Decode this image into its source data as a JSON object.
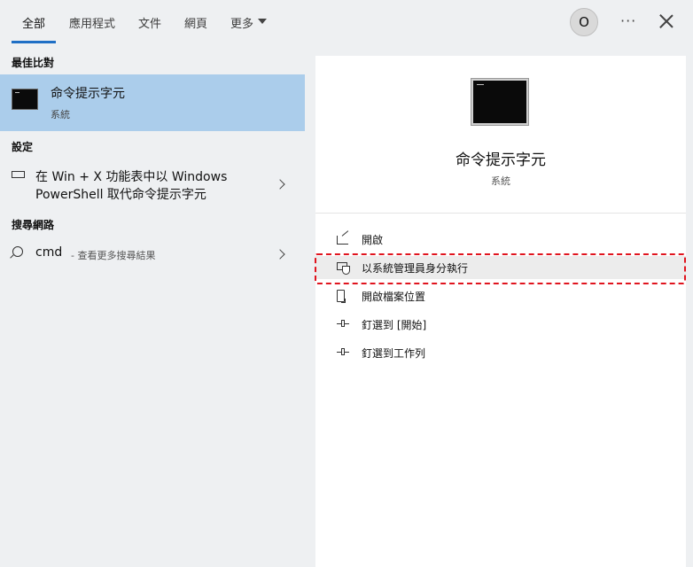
{
  "tabs": [
    {
      "label": "全部",
      "active": true
    },
    {
      "label": "應用程式"
    },
    {
      "label": "文件"
    },
    {
      "label": "網頁"
    },
    {
      "label": "更多"
    }
  ],
  "header": {
    "avatar_initial": "O",
    "more_label": "···"
  },
  "colors": {
    "accent": "#1f6fc5",
    "selected": "#abcdeb",
    "highlight_border": "#e0141e"
  },
  "best_match": {
    "section": "最佳比對",
    "title": "命令提示字元",
    "subtitle": "系統",
    "icon": "command-prompt-icon"
  },
  "settings": {
    "section": "設定",
    "line1": "在 Win + X 功能表中以 Windows",
    "line2": "PowerShell 取代命令提示字元",
    "icon": "keyboard-icon"
  },
  "web": {
    "section": "搜尋網路",
    "query": "cmd",
    "hint": "- 查看更多搜尋結果",
    "icon": "search-icon"
  },
  "preview": {
    "title": "命令提示字元",
    "subtitle": "系統",
    "actions": [
      {
        "label": "開啟",
        "icon": "open-icon"
      },
      {
        "label": "以系統管理員身分執行",
        "icon": "admin-shield-icon"
      },
      {
        "label": "開啟檔案位置",
        "icon": "file-location-icon"
      },
      {
        "label": "釘選到 [開始]",
        "icon": "pin-icon"
      },
      {
        "label": "釘選到工作列",
        "icon": "pin-icon"
      }
    ]
  }
}
